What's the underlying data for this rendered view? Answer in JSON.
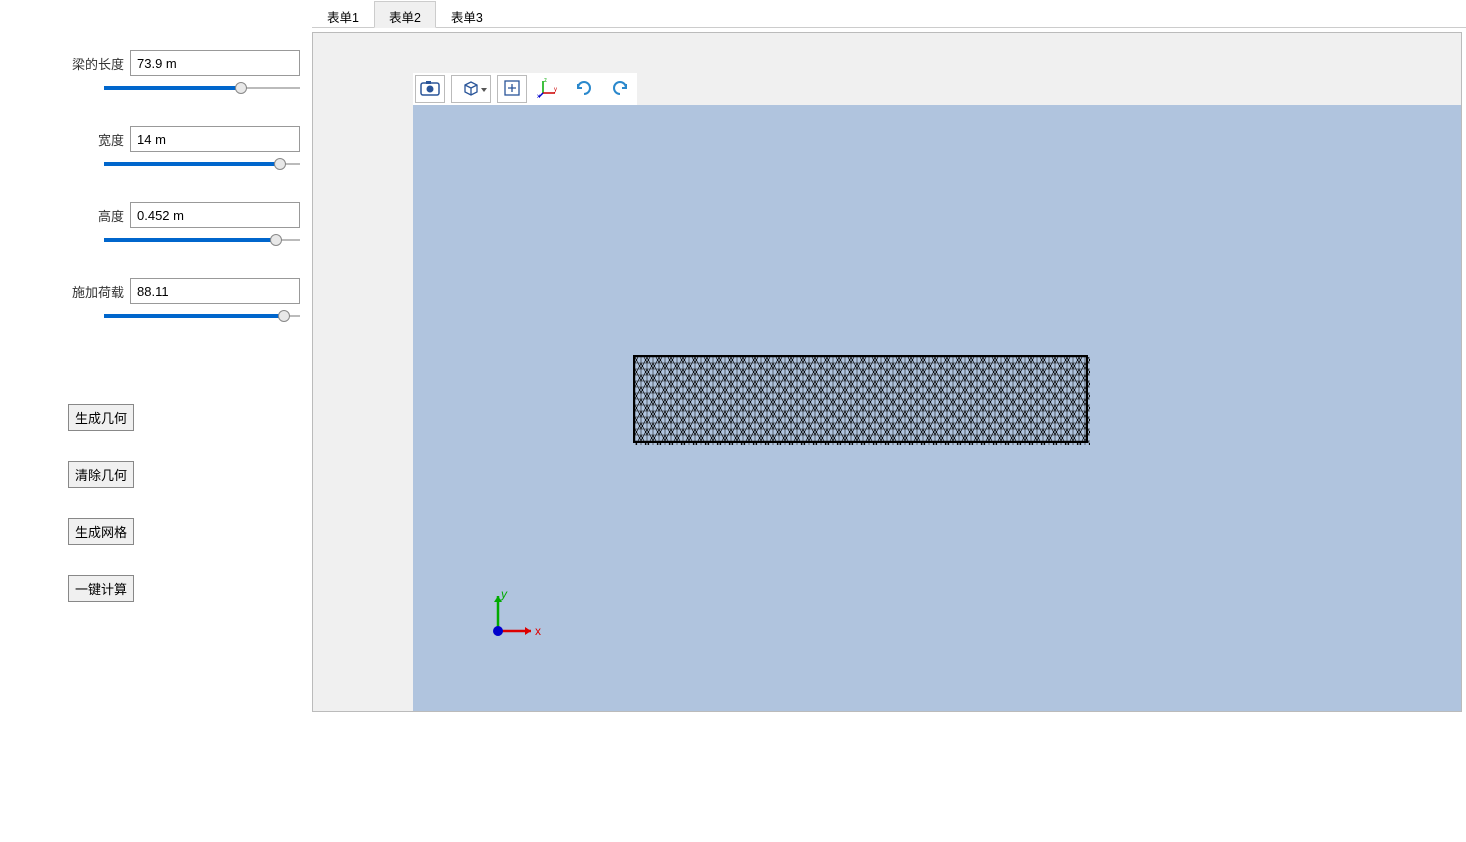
{
  "sidebar": {
    "fields": [
      {
        "label": "梁的长度",
        "value": "73.9 m",
        "slider_pct": 70
      },
      {
        "label": "宽度",
        "value": "14 m",
        "slider_pct": 90
      },
      {
        "label": "高度",
        "value": "0.452 m",
        "slider_pct": 88
      },
      {
        "label": "施加荷载",
        "value": "88.11",
        "slider_pct": 92
      }
    ],
    "buttons": {
      "generate_geometry": "生成几何",
      "clear_geometry": "清除几何",
      "generate_mesh": "生成网格",
      "one_click_compute": "一键计算"
    }
  },
  "tabs": {
    "items": [
      "表单1",
      "表单2",
      "表单3"
    ],
    "active_index": 1
  },
  "toolbar": {
    "icons": [
      "camera",
      "cube",
      "fit",
      "axes",
      "rotate-ccw",
      "rotate-cw"
    ]
  },
  "axis": {
    "x": "x",
    "y": "y"
  }
}
